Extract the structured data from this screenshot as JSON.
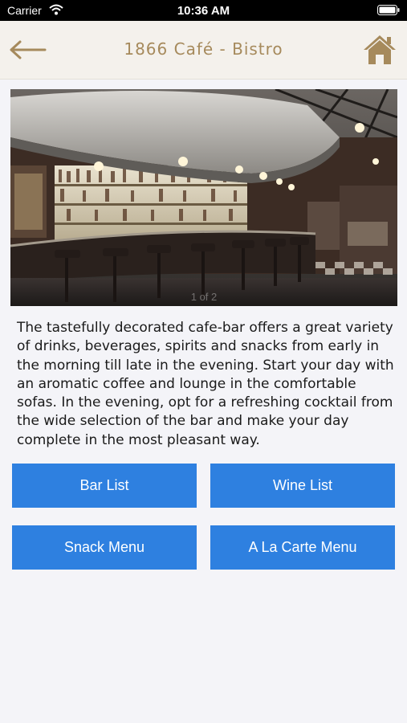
{
  "status_bar": {
    "carrier": "Carrier",
    "time": "10:36 AM"
  },
  "nav": {
    "title": "1866 Café - Bistro",
    "back_icon": "back-arrow-icon",
    "home_icon": "home-icon",
    "accent_color": "#a68a5c"
  },
  "hero": {
    "page_indicator": "1 of 2"
  },
  "description": "The tastefully decorated cafe-bar offers a great variety of drinks, beverages, spirits and snacks from early in the morning till late in the evening. Start your day with an aromatic coffee and lounge in the comfortable sofas. In the evening, opt for a refreshing cocktail from the wide selection of the bar and make your day complete in the most pleasant way.",
  "buttons": {
    "bar_list": "Bar List",
    "wine_list": "Wine List",
    "snack_menu": "Snack Menu",
    "a_la_carte_menu": "A La Carte Menu",
    "color": "#2e80e0"
  }
}
